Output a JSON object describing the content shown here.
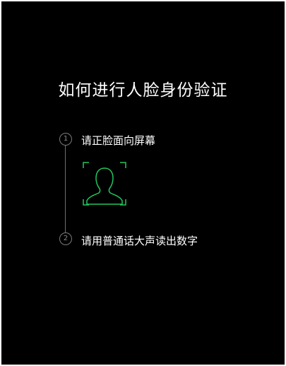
{
  "page": {
    "title": "如何进行人脸身份验证"
  },
  "steps": [
    {
      "number": "1",
      "text": "请正脸面向屏幕"
    },
    {
      "number": "2",
      "text": "请用普通话大声读出数字"
    }
  ],
  "colors": {
    "background": "#000000",
    "text": "#ffffff",
    "accent": "#22c55e",
    "timeline": "#6f6f6f"
  },
  "icons": {
    "face_frame": "face-outline-frame-icon"
  }
}
